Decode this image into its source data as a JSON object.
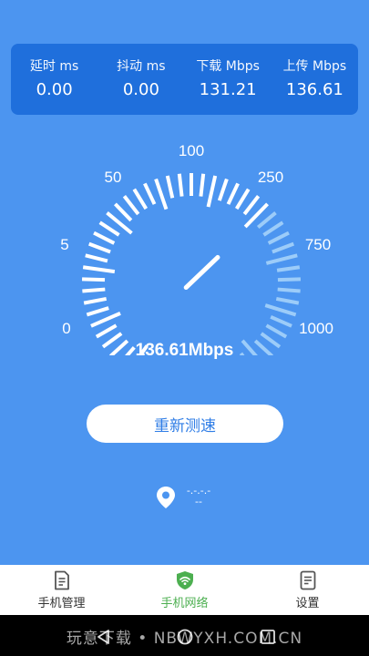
{
  "stats": [
    {
      "label": "延时 ms",
      "value": "0.00"
    },
    {
      "label": "抖动 ms",
      "value": "0.00"
    },
    {
      "label": "下载 Mbps",
      "value": "131.21"
    },
    {
      "label": "上传 Mbps",
      "value": "136.61"
    }
  ],
  "gauge": {
    "scale_labels": [
      "0",
      "5",
      "50",
      "100",
      "250",
      "750",
      "1000"
    ],
    "needle_level": 0.66,
    "speed_text": "136.61Mbps"
  },
  "retest_label": "重新测速",
  "location": {
    "line1": "-.-.-.-",
    "line2": "--"
  },
  "tabs": [
    {
      "label": "手机管理",
      "icon": "document-icon",
      "active": false
    },
    {
      "label": "手机网络",
      "icon": "wifi-shield-icon",
      "active": true
    },
    {
      "label": "设置",
      "icon": "settings-document-icon",
      "active": false
    }
  ],
  "watermark": "玩意下载 • NBWYXH.COM.CN",
  "colors": {
    "background": "#4c95f0",
    "card": "#1f6fdc",
    "active_tab": "#4caf50",
    "button_text": "#2f7de6"
  }
}
